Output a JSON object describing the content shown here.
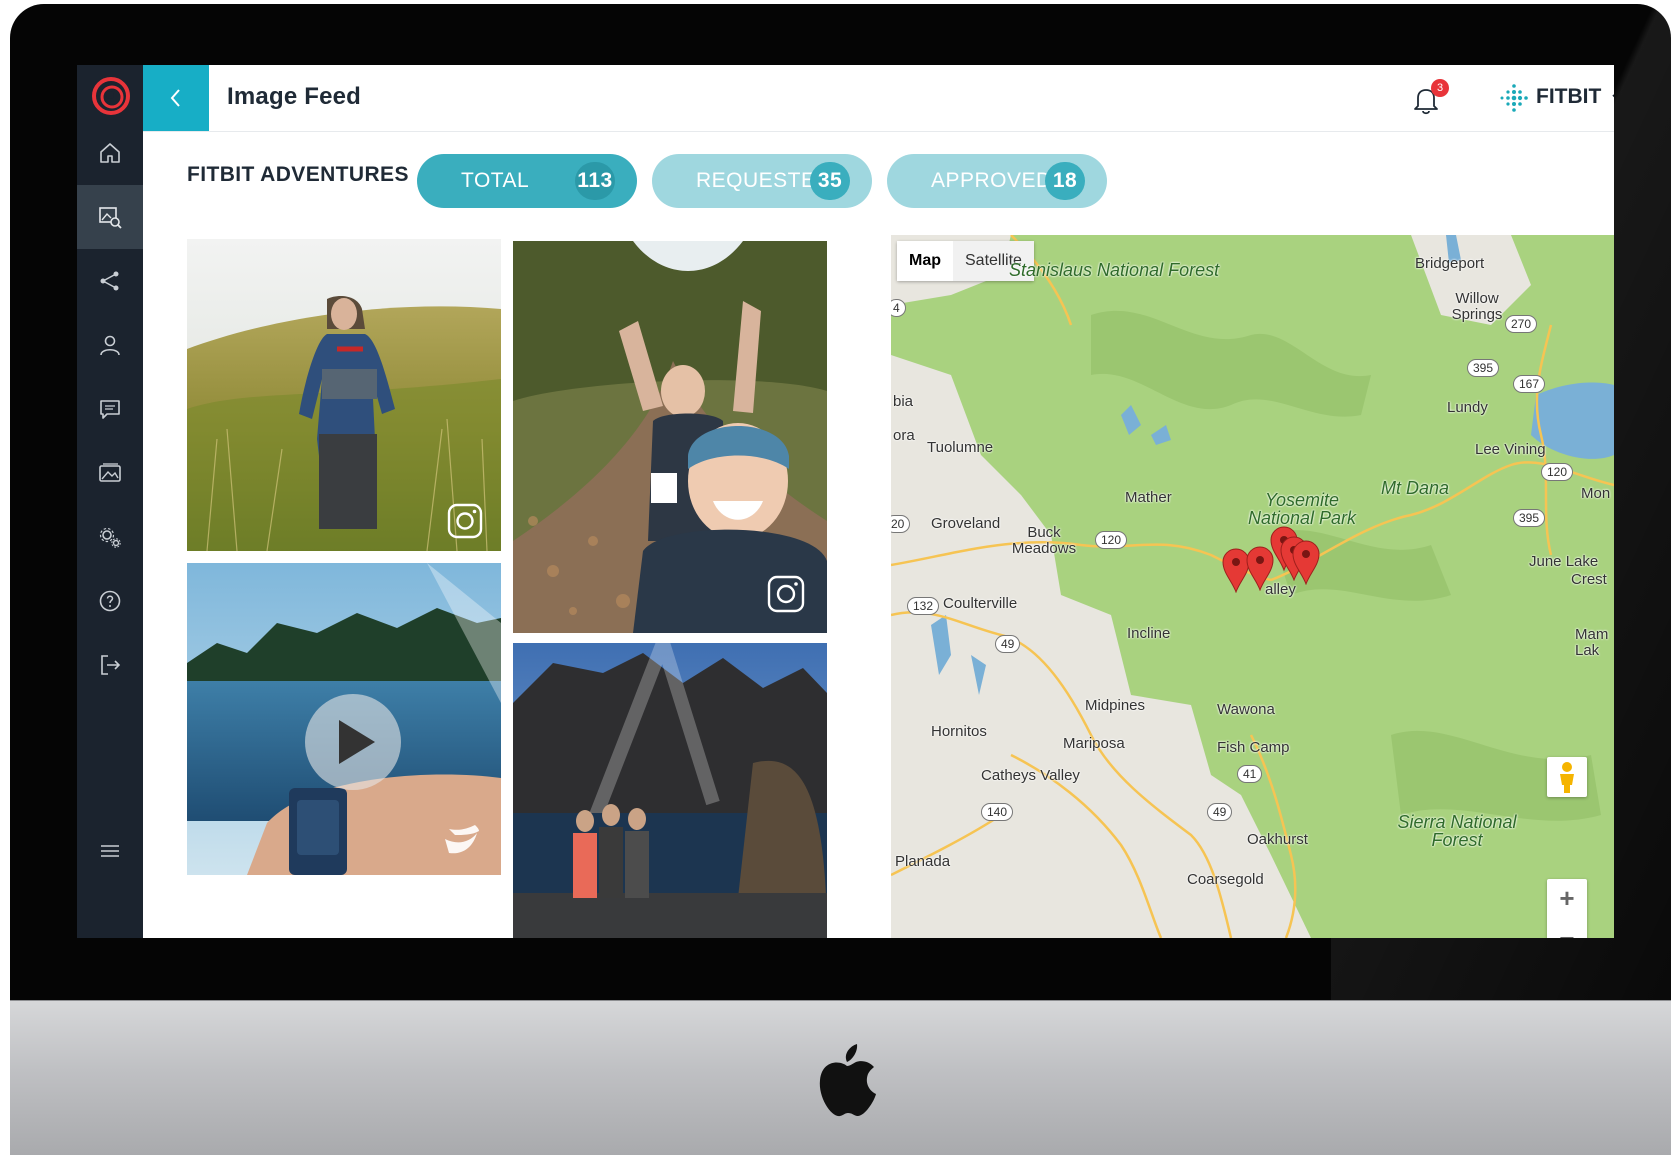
{
  "header": {
    "title": "Image Feed",
    "notification_count": "3",
    "brand": "FITBIT"
  },
  "feed": {
    "name": "FITBIT ADVENTURES",
    "filters": [
      {
        "label": "TOTAL",
        "count": "113"
      },
      {
        "label": "REQUESTED",
        "count": "35"
      },
      {
        "label": "APPROVED",
        "count": "18"
      }
    ]
  },
  "icons": {
    "logo": "ring-logo-icon",
    "back": "chevron-left-icon",
    "nav": [
      "home-icon",
      "image-search-icon",
      "share-icon",
      "user-icon",
      "chat-icon",
      "gallery-icon",
      "settings-icon",
      "help-icon",
      "logout-icon",
      "menu-icon"
    ],
    "notification": "bell-icon",
    "brand": "fitbit-dots-icon",
    "photo_sources": [
      "instagram-icon",
      "instagram-icon",
      "twitter-icon"
    ]
  },
  "map": {
    "toggle": {
      "map": "Map",
      "satellite": "Satellite"
    },
    "zoom_in": "+",
    "zoom_out": "−",
    "places": [
      "Stanislaus National Forest",
      "Bridgeport",
      "Willow Springs",
      "Lundy",
      "Lee Vining",
      "Mt Dana",
      "Mon",
      "Tuolumne",
      "Mather",
      "Yosemite National Park",
      "Groveland",
      "Buck Meadows",
      "Coulterville",
      "June Lake",
      "Crest",
      "Incline",
      "Midpines",
      "Wawona",
      "Hornitos",
      "Mariposa",
      "Fish Camp",
      "Catheys Valley",
      "Oakhurst",
      "Sierra National Forest",
      "Planada",
      "Coarsegold",
      "Mam Lak",
      "bia",
      "ora",
      "alley"
    ],
    "routes": [
      "270",
      "395",
      "167",
      "120",
      "120",
      "395",
      "132",
      "49",
      "41",
      "140",
      "49",
      "4",
      "20"
    ],
    "marker_count": 5
  },
  "colors": {
    "sidebar": "#1b232e",
    "accent": "#17aec6",
    "pill_active": "#3aaebe",
    "pill_inactive": "#9fd7df",
    "badge": "#e8343a",
    "map_green": "#a7d17d",
    "marker": "#e53935"
  }
}
